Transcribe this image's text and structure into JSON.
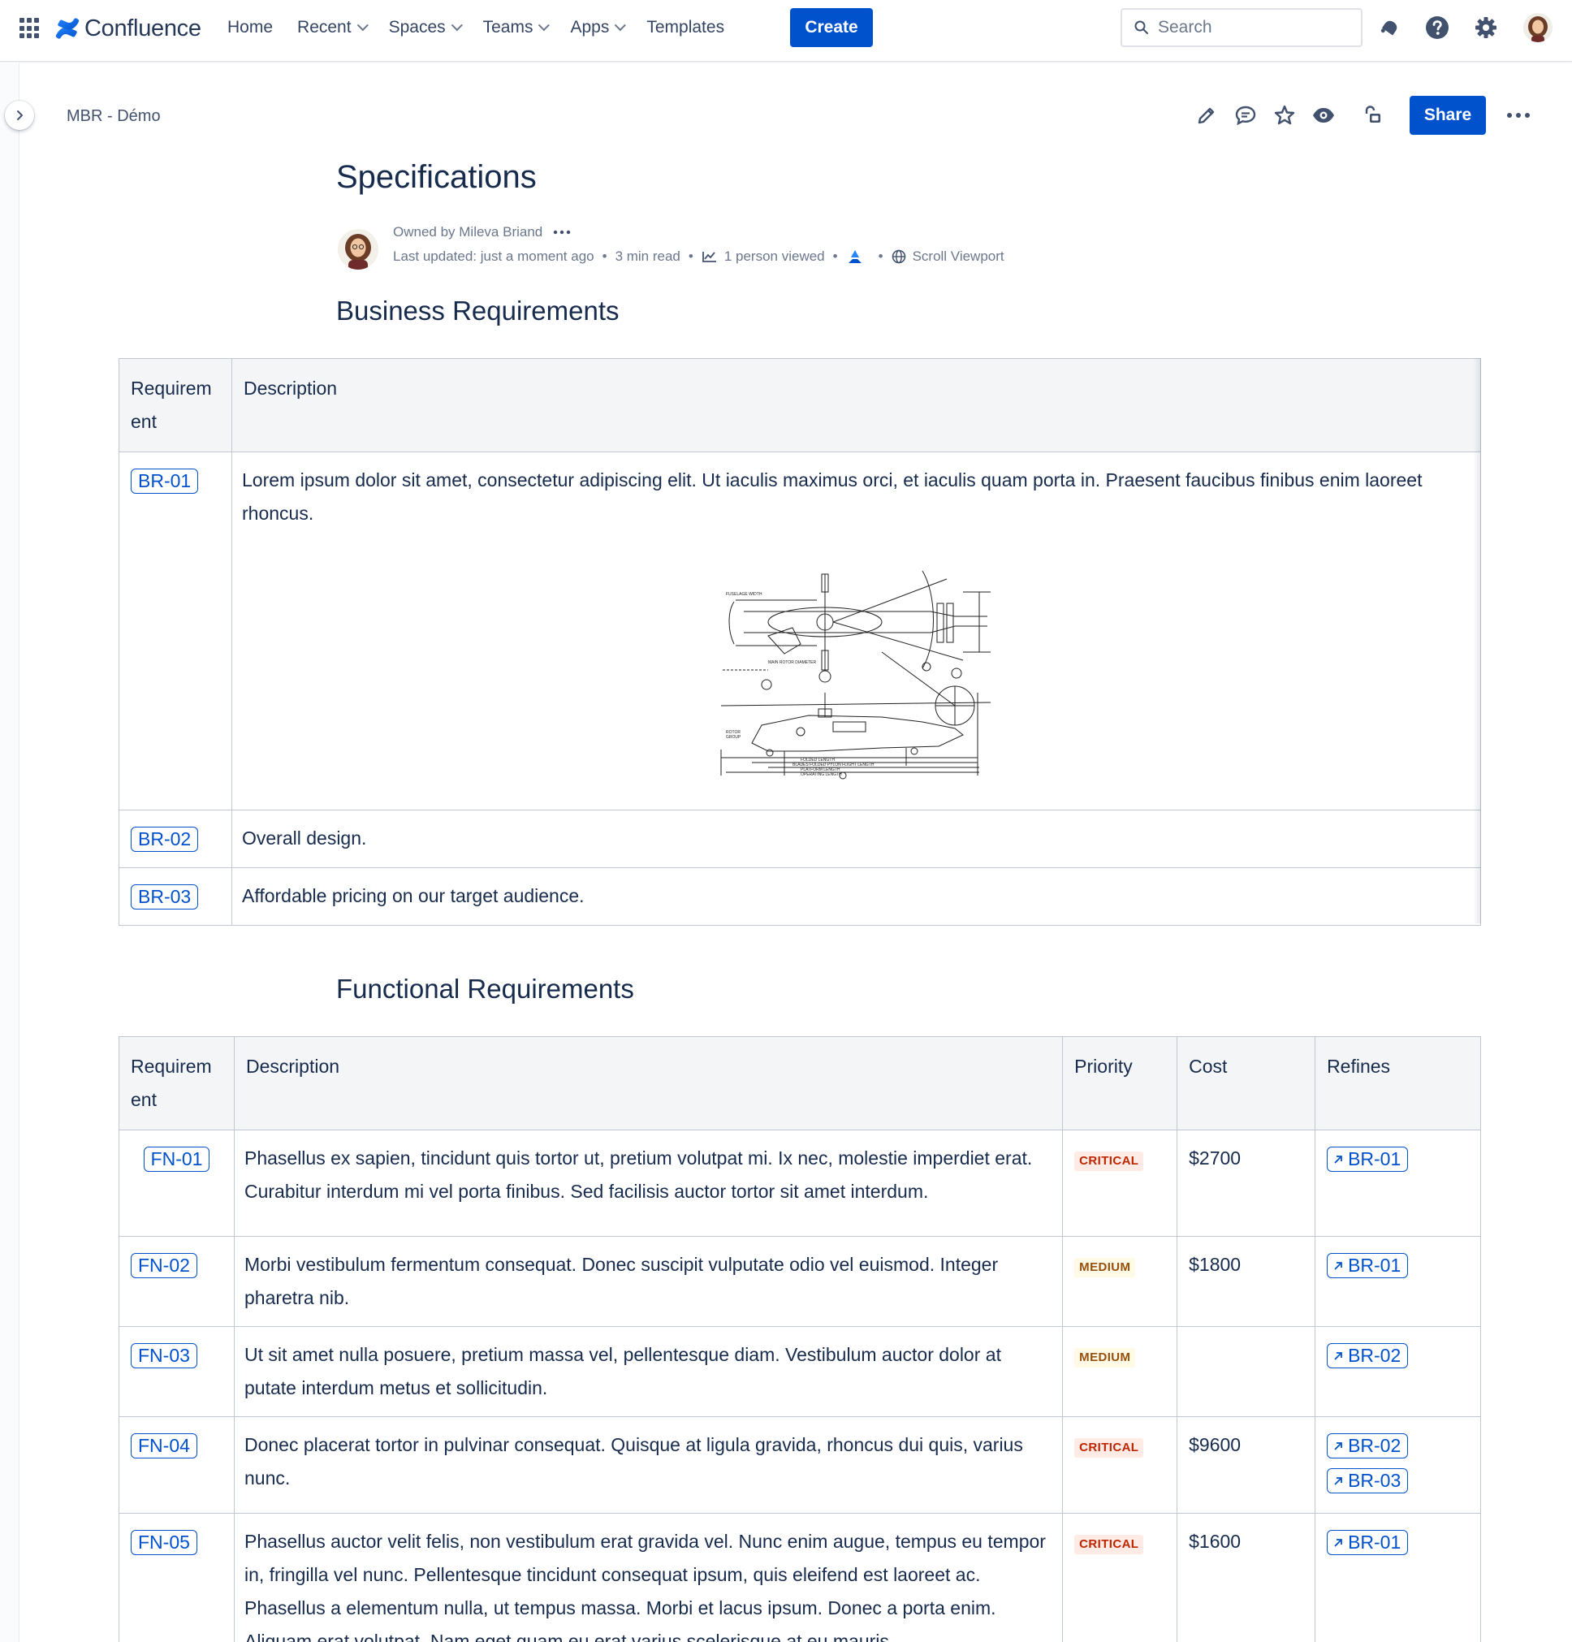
{
  "topnav": {
    "logo_text": "Confluence",
    "items": [
      {
        "label": "Home",
        "dropdown": false
      },
      {
        "label": "Recent",
        "dropdown": true
      },
      {
        "label": "Spaces",
        "dropdown": true
      },
      {
        "label": "Teams",
        "dropdown": true
      },
      {
        "label": "Apps",
        "dropdown": true
      },
      {
        "label": "Templates",
        "dropdown": false
      }
    ],
    "create_label": "Create",
    "search_placeholder": "Search",
    "icons": [
      "notifications-icon",
      "help-icon",
      "settings-icon",
      "profile-avatar"
    ]
  },
  "page": {
    "breadcrumb": "MBR - Démo",
    "share_label": "Share",
    "title": "Specifications",
    "owner": "Owned by Mileva Briand",
    "last_updated": "Last updated: just a moment ago",
    "read_time": "3 min read",
    "viewed": "1 person viewed",
    "scroll_viewport": "Scroll Viewport"
  },
  "business": {
    "heading": "Business Requirements",
    "headers": [
      "Requirem ent",
      "Description"
    ],
    "rows": [
      {
        "id": "BR-01",
        "description": "Lorem ipsum dolor sit amet, consectetur adipiscing elit. Ut iaculis maximus orci, et iaculis quam porta in. Praesent faucibus finibus enim laoreet rhoncus.",
        "has_image": true
      },
      {
        "id": "BR-02",
        "description": "Overall design."
      },
      {
        "id": "BR-03",
        "description": "Affordable pricing on our target audience."
      }
    ]
  },
  "functional": {
    "heading": "Functional Requirements",
    "headers": [
      "Requirem ent",
      "Description",
      "Priority",
      "Cost",
      "Refines"
    ],
    "rows": [
      {
        "id": "FN-01",
        "description": "Phasellus ex sapien, tincidunt quis tortor ut, pretium volutpat mi. Ix nec, molestie imperdiet erat. Curabitur interdum mi vel porta finibus. Sed facilisis auctor tortor sit amet interdum.",
        "priority": "CRITICAL",
        "cost": "$2700",
        "refines": [
          "BR-01"
        ]
      },
      {
        "id": "FN-02",
        "description": "Morbi vestibulum fermentum consequat. Donec suscipit vulputate odio vel euismod. Integer pharetra nib.",
        "priority": "MEDIUM",
        "cost": "$1800",
        "refines": [
          "BR-01"
        ]
      },
      {
        "id": "FN-03",
        "description": "Ut sit amet nulla posuere, pretium massa vel, pellentesque diam. Vestibulum auctor dolor at putate interdum metus et sollicitudin.",
        "priority": "MEDIUM",
        "cost": "",
        "refines": [
          "BR-02"
        ]
      },
      {
        "id": "FN-04",
        "description": "Donec placerat tortor in pulvinar consequat. Quisque at ligula gravida, rhoncus dui quis, varius nunc.",
        "priority": "CRITICAL",
        "cost": "$9600",
        "refines": [
          "BR-02",
          "BR-03"
        ]
      },
      {
        "id": "FN-05",
        "description": "Phasellus auctor velit felis, non vestibulum erat gravida vel. Nunc enim augue, tempus eu tempor in, fringilla vel nunc. Pellentesque tincidunt consequat ipsum, quis eleifend est laoreet ac. Phasellus a elementum nulla, ut tempus massa. Morbi et lacus ipsum. Donec a porta enim. Aliquam erat volutpat. Nam eget quam eu erat varius scelerisque at eu mauris.",
        "priority": "CRITICAL",
        "cost": "$1600",
        "refines": [
          "BR-01"
        ]
      }
    ]
  },
  "colors": {
    "primary": "#0052cc",
    "text": "#172b4d",
    "critical_bg": "#ffebe6",
    "critical_fg": "#bf2600",
    "medium_bg": "#fffae6",
    "medium_fg": "#974f0c"
  }
}
